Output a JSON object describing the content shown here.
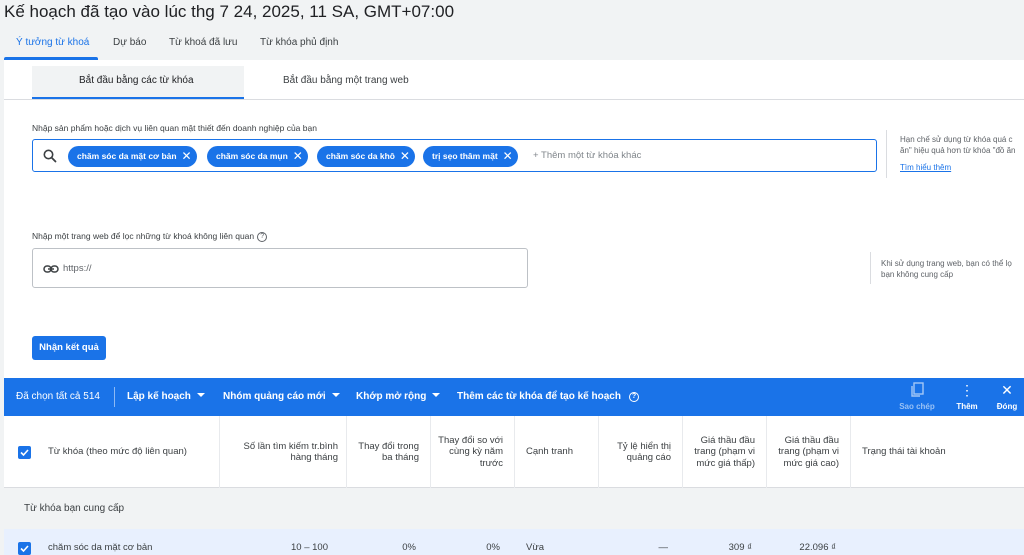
{
  "header": {
    "title": "Kế hoạch đã tạo vào lúc thg 7 24, 2025, 11 SA, GMT+07:00"
  },
  "tabs": [
    {
      "label": "Ý tưởng từ khoá",
      "active": true
    },
    {
      "label": "Dự báo"
    },
    {
      "label": "Từ khoá đã lưu"
    },
    {
      "label": "Từ khóa phủ định"
    }
  ],
  "subtabs": [
    {
      "label": "Bắt đầu bằng các từ khóa",
      "active": true
    },
    {
      "label": "Bắt đầu bằng một trang web"
    }
  ],
  "keywords_section": {
    "label": "Nhập sản phẩm hoặc dịch vụ liên quan mật thiết đến doanh nghiệp của bạn",
    "chips": [
      "chăm sóc da mặt cơ bản",
      "chăm sóc da mụn",
      "chăm sóc da khô",
      "trị sẹo thâm mặt"
    ],
    "placeholder": "+ Thêm một từ khóa khác",
    "side_note_1": "Hạn chế sử dụng từ khóa quá c",
    "side_note_2": "ăn\" hiệu quả hơn từ khóa \"đồ ăn",
    "side_link": "Tìm hiểu thêm"
  },
  "website_section": {
    "label": "Nhập một trang web để lọc những từ khoá không liên quan",
    "help": "?",
    "placeholder": "https://",
    "side_note_1": "Khi sử dụng trang web, bạn có thể lọ",
    "side_note_2": "bạn không cung cấp"
  },
  "results_button": "Nhận kết quả",
  "action_bar": {
    "selected": "Đã chọn tất cả 514",
    "plan": "Lập kế hoạch",
    "new_ad_group": "Nhóm quảng cáo mới",
    "broad_match": "Khớp mở rộng",
    "add_keywords": "Thêm các từ khóa để tạo kế hoạch",
    "help": "?",
    "copy": "Sao chép",
    "more": "Thêm",
    "close": "Đóng",
    "colors": {
      "bar": "#1a73e8"
    }
  },
  "table": {
    "columns": [
      "Từ khóa (theo mức độ liên quan)",
      "Số lần tìm kiếm tr.bình hàng tháng",
      "Thay đổi trong ba tháng",
      "Thay đổi so với cùng kỳ năm trước",
      "Cạnh tranh",
      "Tỷ lệ hiển thị quảng cáo",
      "Giá thầu đầu trang (phạm vi mức giá thấp)",
      "Giá thầu đầu trang (phạm vi mức giá cao)",
      "Trạng thái tài khoản"
    ],
    "group_label": "Từ khóa bạn cung cấp",
    "rows": [
      {
        "keyword": "chăm sóc da mặt cơ bản",
        "searches": "10 – 100",
        "three_month": "0%",
        "yoy": "0%",
        "competition": "Vừa",
        "impression_share": "—",
        "bid_low": "309 ₫",
        "bid_high": "22.096 ₫",
        "status": ""
      }
    ]
  }
}
